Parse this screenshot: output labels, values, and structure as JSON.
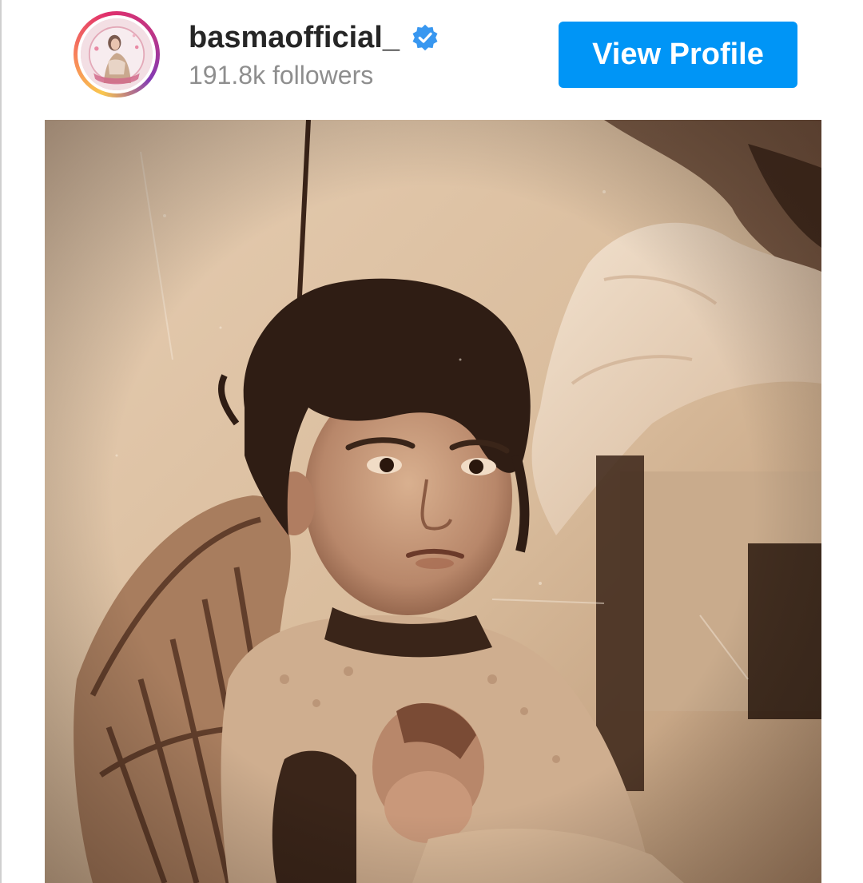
{
  "post_header": {
    "username": "basmaofficial_",
    "verified": true,
    "followers_text": "191.8k followers",
    "view_profile_label": "View Profile",
    "avatar_icon": "profile-avatar",
    "verified_icon": "verified-badge-icon"
  },
  "post": {
    "image_description_icon": "sepia-photo",
    "colors": {
      "button": "#0095f6",
      "verified": "#3897f0",
      "sepia_light": "#e3cbb0",
      "sepia_dark": "#3a2519"
    }
  }
}
